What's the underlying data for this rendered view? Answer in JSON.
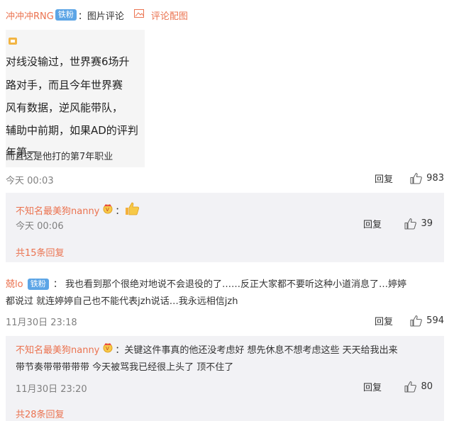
{
  "top": {
    "username": "冲冲冲RNG",
    "badge": "铁粉",
    "separator": "：",
    "content": "图片评论",
    "image_comment_link": "评论配图"
  },
  "image": {
    "lines": [
      "对线没输过，世界赛6场升",
      "路对手，而且今年世界赛",
      "风有数据，逆风能带队，",
      "辅助中前期，如果AD的评判",
      "年第一"
    ],
    "caption": "而且这是他打的第7年职业"
  },
  "comment1": {
    "time": "今天 00:03",
    "reply": "回复",
    "likes": "983",
    "reply_box": {
      "username": "不知名最美狗nanny",
      "separator": "：",
      "time": "今天 00:06",
      "reply": "回复",
      "likes": "39",
      "more": "共15条回复"
    }
  },
  "comment2": {
    "username": "兢lo",
    "badge": "铁粉",
    "separator": "：",
    "text_line1": "我也看到那个很绝对地说不会退役的了……反正大家都不要听这种小道消息了…婷婷",
    "text_line2": "都说过 就连婷婷自己也不能代表jzh说话…我永远相信jzh",
    "time": "11月30日 23:18",
    "reply": "回复",
    "likes": "594",
    "reply_box": {
      "username": "不知名最美狗nanny",
      "separator": "：",
      "text_line1": "关键这件事真的他还没考虑好 想先休息不想考虑这些 天天给我出来",
      "text_line2": "带节奏带带带带带 今天被骂我已经很上头了 顶不住了",
      "time": "11月30日 23:20",
      "reply": "回复",
      "likes": "80",
      "more": "共28条回复"
    }
  },
  "colors": {
    "link": "#eb7350",
    "badge": "#5ca5e6",
    "reply_bg": "#f2f2f5"
  }
}
